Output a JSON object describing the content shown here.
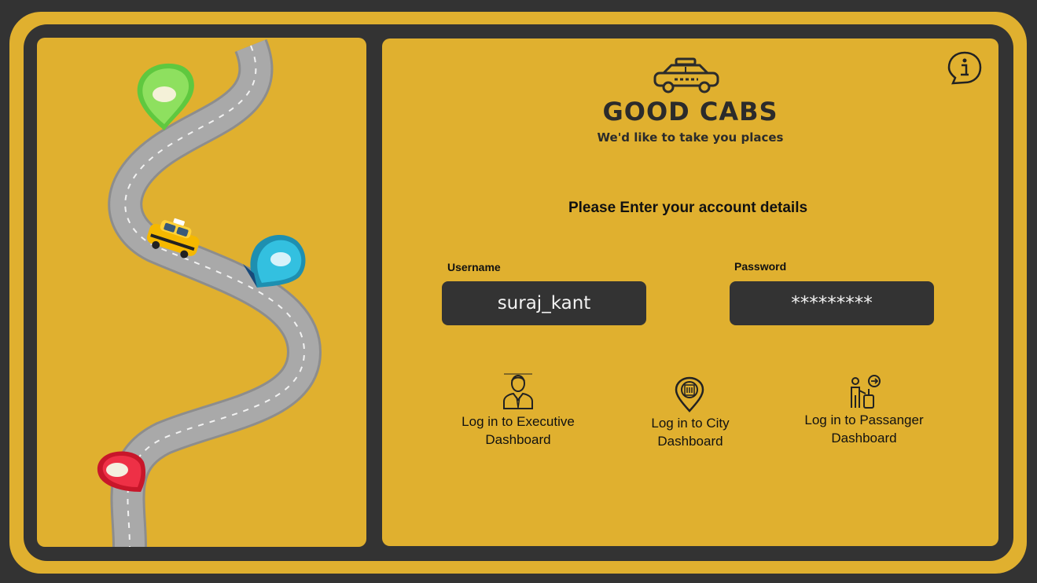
{
  "brand": {
    "title": "GOOD CABS",
    "tagline": "We'd like to take you places"
  },
  "form": {
    "heading": "Please Enter your account details",
    "username_label": "Username",
    "username_value": "suraj_kant",
    "password_label": "Password",
    "password_value": "*********"
  },
  "dashboard_links": [
    {
      "line1": "Log in to Executive",
      "line2": "Dashboard",
      "icon": "executive-person-icon"
    },
    {
      "line1": "Log in to City",
      "line2": "Dashboard",
      "icon": "city-location-pin-icon"
    },
    {
      "line1": "Log in to Passanger",
      "line2": "Dashboard",
      "icon": "passenger-luggage-icon"
    }
  ],
  "icons": {
    "info": "info-speech-icon",
    "logo": "taxi-icon"
  },
  "colors": {
    "frame": "#333333",
    "accent": "#E0B02F",
    "pin_green": "#7ED957",
    "pin_blue": "#2DB7D8",
    "pin_red": "#E8243A",
    "taxi": "#F5B800"
  }
}
